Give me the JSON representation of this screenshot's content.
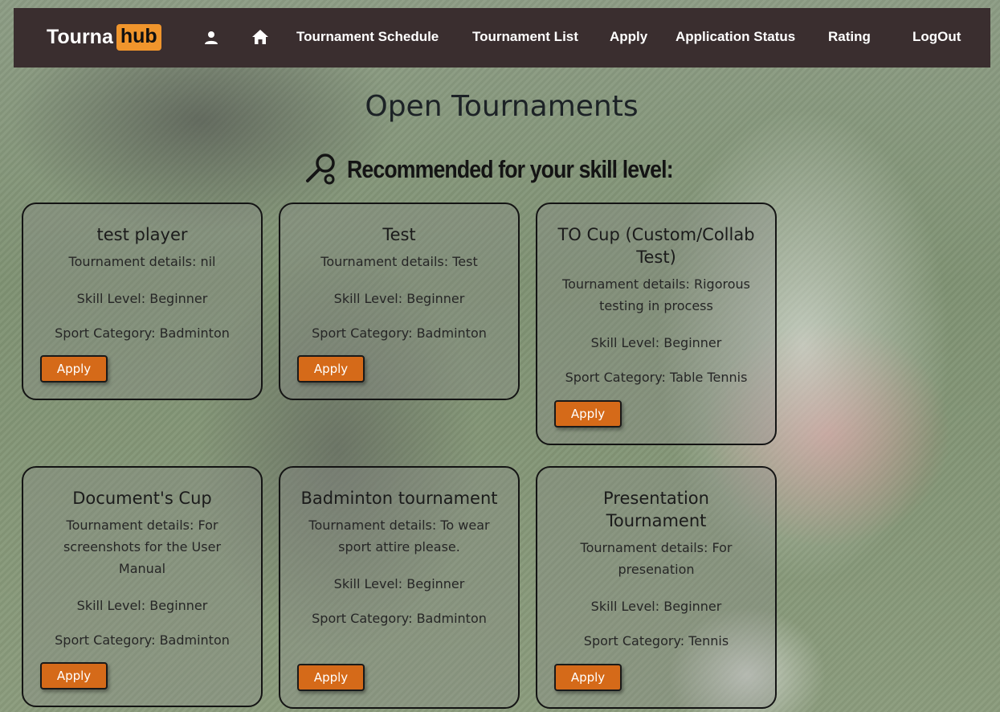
{
  "nav": {
    "logo_part1": "Tourna",
    "logo_part2": "hub",
    "profile_icon": "person-icon",
    "home_icon": "home-icon",
    "links": [
      "Tournament Schedule",
      "Tournament List",
      "Apply",
      "Application Status",
      "Rating",
      "LogOut"
    ]
  },
  "page_title": "Open Tournaments",
  "recommended": {
    "icon": "racket-icon",
    "heading": "Recommended for your skill level:"
  },
  "cards": [
    {
      "title": "test player",
      "details": "Tournament details: nil",
      "skill": "Skill Level: Beginner",
      "sport": "Sport Category: Badminton",
      "apply_label": "Apply"
    },
    {
      "title": "Test",
      "details": "Tournament details: Test",
      "skill": "Skill Level: Beginner",
      "sport": "Sport Category: Badminton",
      "apply_label": "Apply"
    },
    {
      "title": "TO Cup (Custom/Collab Test)",
      "details": "Tournament details: Rigorous testing in process",
      "skill": "Skill Level: Beginner",
      "sport": "Sport Category: Table Tennis",
      "apply_label": "Apply"
    },
    {
      "title": "Document's Cup",
      "details": "Tournament details: For screenshots for the User Manual",
      "skill": "Skill Level: Beginner",
      "sport": "Sport Category: Badminton",
      "apply_label": "Apply"
    },
    {
      "title": "Badminton tournament",
      "details": "Tournament details: To wear sport attire please.",
      "skill": "Skill Level: Beginner",
      "sport": "Sport Category: Badminton",
      "apply_label": "Apply"
    },
    {
      "title": "Presentation Tournament",
      "details": "Tournament details: For presenation",
      "skill": "Skill Level: Beginner",
      "sport": "Sport Category: Tennis",
      "apply_label": "Apply"
    }
  ],
  "colors": {
    "navbar": "#3a2e2f",
    "logo_accent": "#f0952c",
    "apply_button": "#d56a19"
  }
}
